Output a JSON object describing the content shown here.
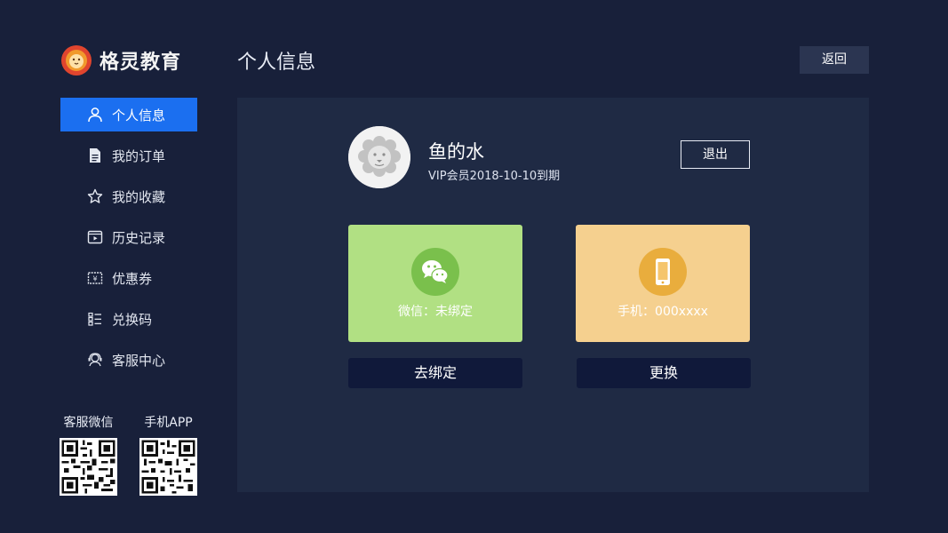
{
  "brand": {
    "name": "格灵教育"
  },
  "header": {
    "title": "个人信息",
    "back_label": "返回"
  },
  "sidebar": {
    "items": [
      {
        "label": "个人信息",
        "icon": "user-icon",
        "active": true
      },
      {
        "label": "我的订单",
        "icon": "document-icon"
      },
      {
        "label": "我的收藏",
        "icon": "star-icon"
      },
      {
        "label": "历史记录",
        "icon": "history-icon"
      },
      {
        "label": "优惠券",
        "icon": "coupon-icon"
      },
      {
        "label": "兑换码",
        "icon": "redeem-code-icon"
      },
      {
        "label": "客服中心",
        "icon": "support-icon"
      }
    ],
    "qr": [
      {
        "label": "客服微信",
        "icon": "qr-code-icon"
      },
      {
        "label": "手机APP",
        "icon": "qr-code-icon"
      }
    ]
  },
  "profile": {
    "username": "鱼的水",
    "vip": "VIP会员2018-10-10到期",
    "logout_label": "退出"
  },
  "bindings": {
    "wechat": {
      "text": "微信：未绑定",
      "action": "去绑定",
      "color": "#b1e083",
      "icon": "wechat-icon"
    },
    "phone": {
      "text": "手机：000xxxx",
      "action": "更换",
      "color": "#f5d08f",
      "icon": "phone-icon"
    }
  },
  "colors": {
    "background": "#18203a",
    "panel": "#1f2a44",
    "accent": "#1b6ff0"
  }
}
